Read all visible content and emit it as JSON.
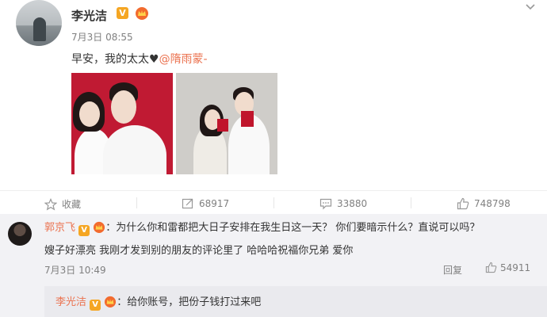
{
  "post": {
    "author": "李光洁",
    "time": "7月3日 08:55",
    "text_prefix": "早安，我的太太♥",
    "mention": "@隋雨蒙-",
    "collapse_icon": "chevron-down-icon"
  },
  "actions": {
    "favorite_label": "收藏",
    "repost_count": "68917",
    "comment_count": "33880",
    "like_count": "748798"
  },
  "comment": {
    "author": "郭京飞",
    "text_line1": "：为什么你和雷都把大日子安排在我生日这一天？ 你们要暗示什么？直说可以吗？",
    "text_line2": "嫂子好漂亮 我刚才发到别的朋友的评论里了 哈哈哈祝福你兄弟 爱你",
    "time": "7月3日 10:49",
    "reply_label": "回复",
    "like_count": "54911"
  },
  "sub_reply": {
    "author": "李光洁",
    "text": "：给你账号，把份子钱打过来吧"
  },
  "colors": {
    "accent": "#eb7350",
    "badge": "#f5a623",
    "comments_bg": "#f2f2f5"
  }
}
